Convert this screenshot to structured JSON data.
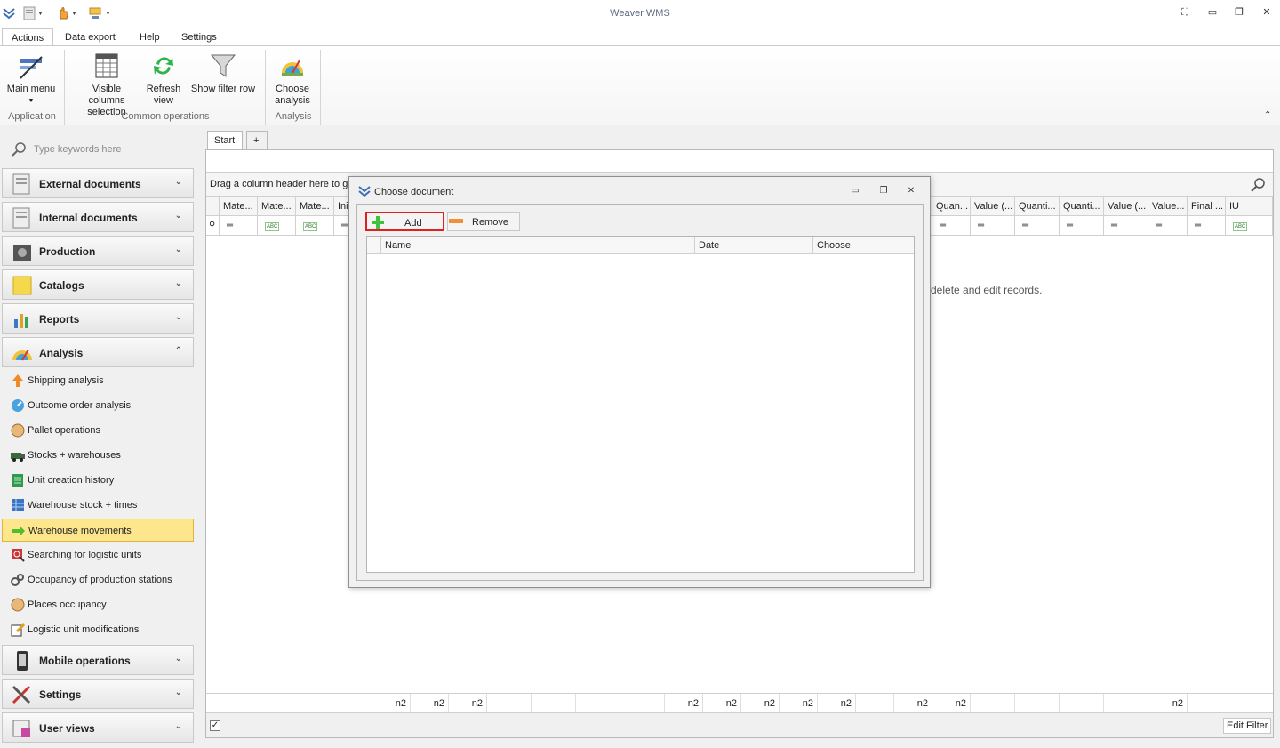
{
  "app": {
    "title": "Weaver WMS"
  },
  "ribbon_tabs": [
    "Actions",
    "Data export",
    "Help",
    "Settings"
  ],
  "ribbon": {
    "buttons": {
      "main_menu": "Main menu",
      "visible_columns": [
        "Visible columns",
        "selection"
      ],
      "refresh": [
        "Refresh",
        "view"
      ],
      "show_filter": "Show filter row",
      "choose_analysis": [
        "Choose",
        "analysis"
      ]
    },
    "groups": {
      "application": "Application",
      "common": "Common operations",
      "analysis": "Analysis"
    }
  },
  "sidebar": {
    "search_placeholder": "Type keywords here",
    "groups_top": [
      "External documents",
      "Internal documents",
      "Production",
      "Catalogs",
      "Reports",
      "Analysis"
    ],
    "analysis_items": [
      "Shipping analysis",
      "Outcome order analysis",
      "Pallet operations",
      "Stocks + warehouses",
      "Unit creation history",
      "Warehouse stock + times",
      "Warehouse movements",
      "Searching for logistic units",
      "Occupancy of production stations",
      "Places occupancy",
      "Logistic unit modifications"
    ],
    "selected_item": "Warehouse movements",
    "groups_bottom": [
      "Mobile operations",
      "Settings",
      "User views"
    ]
  },
  "main": {
    "tabs": [
      "Start",
      "+"
    ],
    "group_panel": "Drag a column header here to gr",
    "columns_left": [
      "Mate...",
      "Mate...",
      "Mate...",
      "Ini"
    ],
    "columns_right": [
      "Quan...",
      "Value (...",
      "Quanti...",
      "Quanti...",
      "Value (...",
      "Value...",
      "Final ...",
      "IU"
    ],
    "empty_message": "delete  and  edit records.",
    "summaries_left": [
      "n2",
      "n2",
      "n2"
    ],
    "summaries_right": [
      "n2",
      "n2",
      "n2",
      "n2",
      "n2",
      "n2",
      "n2",
      "n2"
    ],
    "edit_filter": "Edit Filter"
  },
  "dialog": {
    "title": "Choose document",
    "add": "Add",
    "remove": "Remove",
    "columns": [
      "Name",
      "Date",
      "Choose"
    ]
  }
}
